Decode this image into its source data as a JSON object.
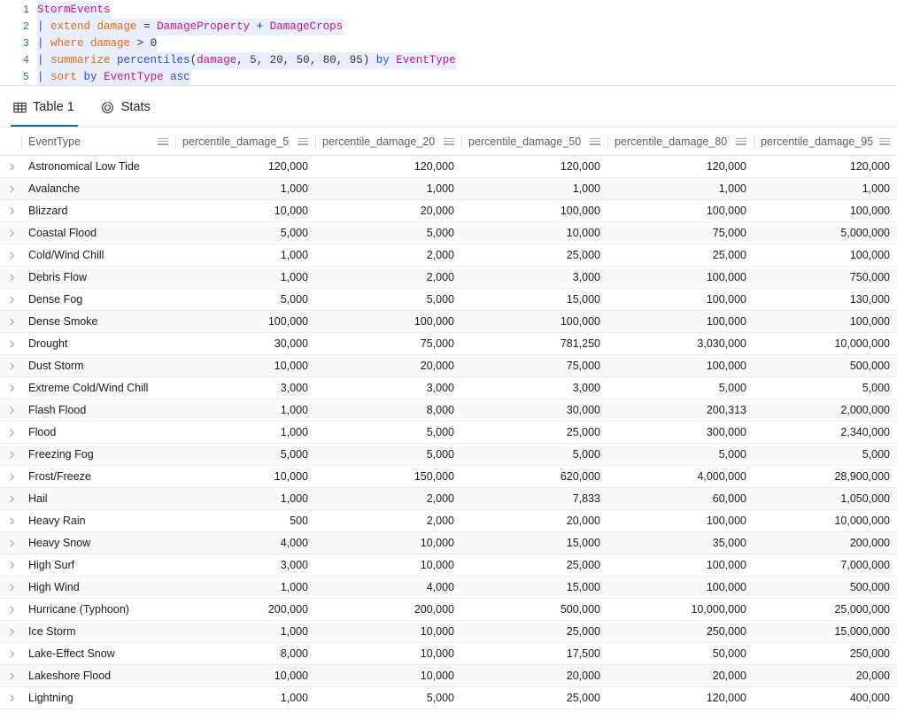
{
  "editor": {
    "line_numbers": [
      "1",
      "2",
      "3",
      "4",
      "5"
    ],
    "lines": [
      {
        "n": "1",
        "tokens": [
          {
            "t": "StormEvents",
            "c": "tok-table"
          }
        ]
      },
      {
        "n": "2",
        "tokens": [
          {
            "t": "| ",
            "c": "tok-pipe"
          },
          {
            "t": "extend",
            "c": "tok-kw"
          },
          {
            "t": " ",
            "c": "tok-plain"
          },
          {
            "t": "damage",
            "c": "tok-kw"
          },
          {
            "t": " = ",
            "c": "tok-op"
          },
          {
            "t": "DamageProperty",
            "c": "tok-ident"
          },
          {
            "t": " + ",
            "c": "tok-op"
          },
          {
            "t": "DamageCrops",
            "c": "tok-ident"
          }
        ]
      },
      {
        "n": "3",
        "tokens": [
          {
            "t": "| ",
            "c": "tok-pipe"
          },
          {
            "t": "where",
            "c": "tok-kw"
          },
          {
            "t": " ",
            "c": "tok-plain"
          },
          {
            "t": "damage",
            "c": "tok-kw"
          },
          {
            "t": " > ",
            "c": "tok-op"
          },
          {
            "t": "0",
            "c": "tok-num"
          }
        ]
      },
      {
        "n": "4",
        "tokens": [
          {
            "t": "| ",
            "c": "tok-pipe"
          },
          {
            "t": "summarize",
            "c": "tok-kw"
          },
          {
            "t": " ",
            "c": "tok-plain"
          },
          {
            "t": "percentiles",
            "c": "tok-fn"
          },
          {
            "t": "(",
            "c": "tok-punc"
          },
          {
            "t": "damage",
            "c": "tok-ident"
          },
          {
            "t": ", ",
            "c": "tok-punc"
          },
          {
            "t": "5",
            "c": "tok-num"
          },
          {
            "t": ", ",
            "c": "tok-punc"
          },
          {
            "t": "20",
            "c": "tok-num"
          },
          {
            "t": ", ",
            "c": "tok-punc"
          },
          {
            "t": "50",
            "c": "tok-num"
          },
          {
            "t": ", ",
            "c": "tok-punc"
          },
          {
            "t": "80",
            "c": "tok-num"
          },
          {
            "t": ", ",
            "c": "tok-punc"
          },
          {
            "t": "95",
            "c": "tok-num"
          },
          {
            "t": ") ",
            "c": "tok-punc"
          },
          {
            "t": "by",
            "c": "tok-fn"
          },
          {
            "t": " ",
            "c": "tok-plain"
          },
          {
            "t": "EventType",
            "c": "tok-ident"
          }
        ]
      },
      {
        "n": "5",
        "tokens": [
          {
            "t": "| ",
            "c": "tok-pipe"
          },
          {
            "t": "sort",
            "c": "tok-kw"
          },
          {
            "t": " ",
            "c": "tok-plain"
          },
          {
            "t": "by",
            "c": "tok-fn"
          },
          {
            "t": " ",
            "c": "tok-plain"
          },
          {
            "t": "EventType",
            "c": "tok-ident"
          },
          {
            "t": " ",
            "c": "tok-plain"
          },
          {
            "t": "asc",
            "c": "tok-fn"
          }
        ]
      }
    ],
    "query_text": "StormEvents | extend damage = DamageProperty + DamageCrops | where damage > 0 | summarize percentiles(damage, 5, 20, 50, 80, 95) by EventType | sort by EventType asc"
  },
  "tabs": [
    {
      "label": "Table 1",
      "icon": "table-icon",
      "active": true
    },
    {
      "label": "Stats",
      "icon": "stats-icon",
      "active": false
    }
  ],
  "table": {
    "columns": [
      "EventType",
      "percentile_damage_5",
      "percentile_damage_20",
      "percentile_damage_50",
      "percentile_damage_80",
      "percentile_damage_95"
    ],
    "rows": [
      [
        "Astronomical Low Tide",
        "120,000",
        "120,000",
        "120,000",
        "120,000",
        "120,000"
      ],
      [
        "Avalanche",
        "1,000",
        "1,000",
        "1,000",
        "1,000",
        "1,000"
      ],
      [
        "Blizzard",
        "10,000",
        "20,000",
        "100,000",
        "100,000",
        "100,000"
      ],
      [
        "Coastal Flood",
        "5,000",
        "5,000",
        "10,000",
        "75,000",
        "5,000,000"
      ],
      [
        "Cold/Wind Chill",
        "1,000",
        "2,000",
        "25,000",
        "25,000",
        "100,000"
      ],
      [
        "Debris Flow",
        "1,000",
        "2,000",
        "3,000",
        "100,000",
        "750,000"
      ],
      [
        "Dense Fog",
        "5,000",
        "5,000",
        "15,000",
        "100,000",
        "130,000"
      ],
      [
        "Dense Smoke",
        "100,000",
        "100,000",
        "100,000",
        "100,000",
        "100,000"
      ],
      [
        "Drought",
        "30,000",
        "75,000",
        "781,250",
        "3,030,000",
        "10,000,000"
      ],
      [
        "Dust Storm",
        "10,000",
        "20,000",
        "75,000",
        "100,000",
        "500,000"
      ],
      [
        "Extreme Cold/Wind Chill",
        "3,000",
        "3,000",
        "3,000",
        "5,000",
        "5,000"
      ],
      [
        "Flash Flood",
        "1,000",
        "8,000",
        "30,000",
        "200,313",
        "2,000,000"
      ],
      [
        "Flood",
        "1,000",
        "5,000",
        "25,000",
        "300,000",
        "2,340,000"
      ],
      [
        "Freezing Fog",
        "5,000",
        "5,000",
        "5,000",
        "5,000",
        "5,000"
      ],
      [
        "Frost/Freeze",
        "10,000",
        "150,000",
        "620,000",
        "4,000,000",
        "28,900,000"
      ],
      [
        "Hail",
        "1,000",
        "2,000",
        "7,833",
        "60,000",
        "1,050,000"
      ],
      [
        "Heavy Rain",
        "500",
        "2,000",
        "20,000",
        "100,000",
        "10,000,000"
      ],
      [
        "Heavy Snow",
        "4,000",
        "10,000",
        "15,000",
        "35,000",
        "200,000"
      ],
      [
        "High Surf",
        "3,000",
        "10,000",
        "25,000",
        "100,000",
        "7,000,000"
      ],
      [
        "High Wind",
        "1,000",
        "4,000",
        "15,000",
        "100,000",
        "500,000"
      ],
      [
        "Hurricane (Typhoon)",
        "200,000",
        "200,000",
        "500,000",
        "10,000,000",
        "25,000,000"
      ],
      [
        "Ice Storm",
        "1,000",
        "10,000",
        "25,000",
        "250,000",
        "15,000,000"
      ],
      [
        "Lake-Effect Snow",
        "8,000",
        "10,000",
        "17,500",
        "50,000",
        "250,000"
      ],
      [
        "Lakeshore Flood",
        "10,000",
        "10,000",
        "20,000",
        "20,000",
        "20,000"
      ],
      [
        "Lightning",
        "1,000",
        "5,000",
        "25,000",
        "120,000",
        "400,000"
      ]
    ],
    "row_expander_icon": "chevron-right-icon",
    "column_menu_icon": "hamburger-menu-icon"
  },
  "colors": {
    "accent": "#0f6cbd",
    "code_selection_bg": "#e8eefb",
    "gutter": "#237893",
    "row_alt_bg": "#f8f9fb",
    "grid_line": "#ededed"
  }
}
